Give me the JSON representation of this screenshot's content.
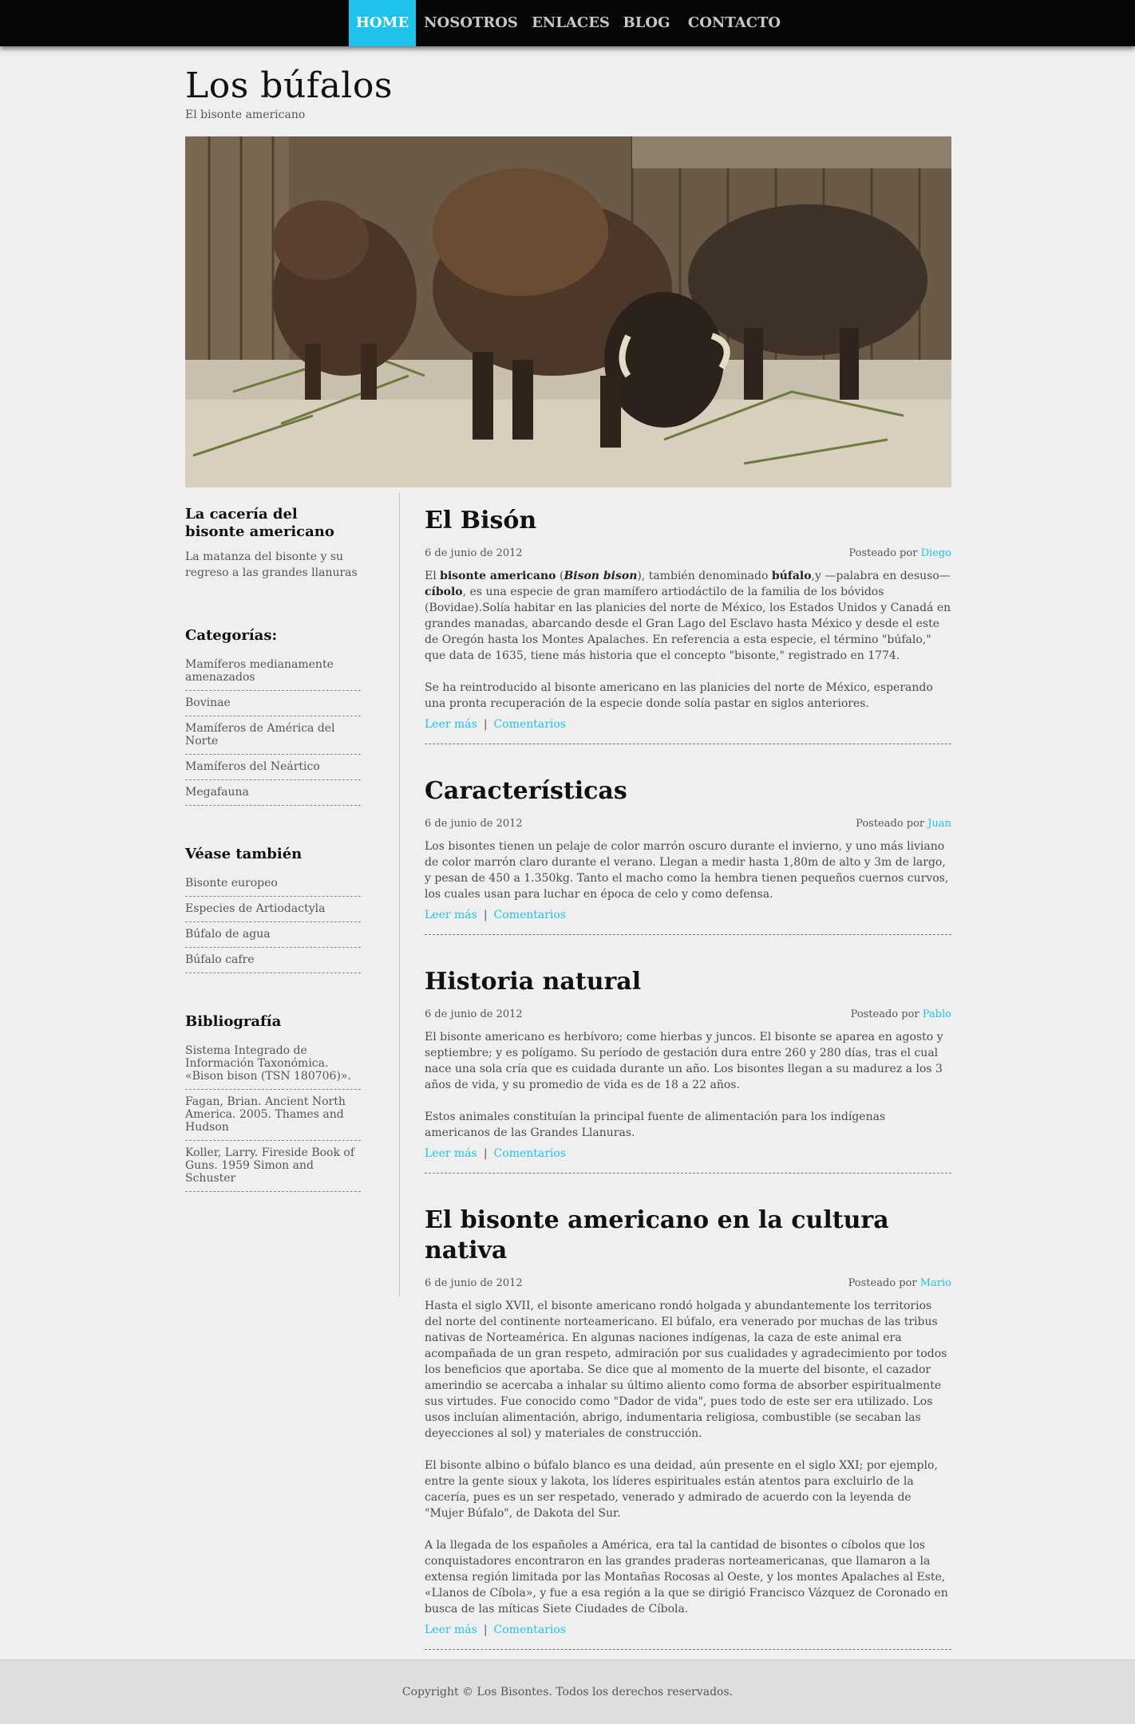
{
  "nav": {
    "items": [
      "HOME",
      "NOSOTROS",
      "ENLACES",
      "BLOG",
      "CONTACTO"
    ],
    "active_index": 0
  },
  "header": {
    "title": "Los búfalos",
    "subtitle": "El bisonte americano"
  },
  "sidebar": {
    "intro_title": "La cacería del bisonte americano",
    "intro_text": "La matanza del bisonte y su regreso a las grandes llanuras",
    "categories_title": "Categorías:",
    "categories": [
      "Mamíferos medianamente amenazados",
      "Bovinae",
      "Mamíferos de América del Norte",
      "Mamíferos del Neártico",
      "Megafauna"
    ],
    "see_also_title": "Véase también",
    "see_also": [
      "Bisonte europeo",
      "Especies de Artiodactyla",
      "Búfalo de agua",
      "Búfalo cafre"
    ],
    "bibliography_title": "Bibliografía",
    "bibliography": [
      "Sistema Integrado de Información Taxonómica. «Bison bison (TSN 180706)».",
      "Fagan, Brian. Ancient North America. 2005. Thames and Hudson",
      "Koller, Larry. Fireside Book of Guns. 1959 Simon and Schuster"
    ]
  },
  "posts": [
    {
      "title": "El Bisón",
      "date": "6 de junio de 2012",
      "posted_by": "Posteado por",
      "author": "Diego",
      "p1_a": "El ",
      "p1_b1": "bisonte americano",
      "p1_c": " (",
      "p1_i": "Bison bison",
      "p1_d": "), también denominado ",
      "p1_b2": "búfalo",
      "p1_e": ",y —palabra en desuso— ",
      "p1_b3": "cíbolo",
      "p1_f": ", es una especie de gran mamífero artiodáctilo de la familia de los bóvidos (Bovidae).Solía habitar en las planicies del norte de México, los Estados Unidos y Canadá en grandes manadas, abarcando desde el Gran Lago del Esclavo hasta México y desde el este de Oregón hasta los Montes Apalaches. En referencia a esta especie, el término \"búfalo,\" que data de 1635, tiene más historia que el concepto \"bisonte,\" registrado en 1774.",
      "p2": "Se ha reintroducido al bisonte americano en las planicies del norte de México, esperando una pronta recuperación de la especie donde solía pastar en siglos anteriores.",
      "read_more": "Leer más",
      "separator": "|",
      "comments": "Comentarios"
    },
    {
      "title": "Características",
      "date": "6 de junio de 2012",
      "posted_by": "Posteado por",
      "author": "Juan",
      "p1": "Los bisontes tienen un pelaje de color marrón oscuro durante el invierno, y uno más liviano de color marrón claro durante el verano. Llegan a medir hasta 1,80m de alto y 3m de largo, y pesan de 450 a 1.350kg. Tanto el macho como la hembra tienen pequeños cuernos curvos, los cuales usan para luchar en época de celo y como defensa.",
      "read_more": "Leer más",
      "separator": "|",
      "comments": "Comentarios"
    },
    {
      "title": "Historia natural",
      "date": "6 de junio de 2012",
      "posted_by": "Posteado por",
      "author": "Pablo",
      "p1": "El bisonte americano es herbívoro; come hierbas y juncos. El bisonte se aparea en agosto y septiembre; y es polígamo. Su período de gestación dura entre 260 y 280 días, tras el cual nace una sola cría que es cuidada durante un año. Los bisontes llegan a su madurez a los 3 años de vida, y su promedio de vida es de 18 a 22 años.",
      "p2": "Estos animales constituían la principal fuente de alimentación para los indígenas americanos de las Grandes Llanuras.",
      "read_more": "Leer más",
      "separator": "|",
      "comments": "Comentarios"
    },
    {
      "title": "El bisonte americano en la cultura nativa",
      "date": "6 de junio de 2012",
      "posted_by": "Posteado por",
      "author": "Mario",
      "p1": "Hasta el siglo XVII, el bisonte americano rondó holgada y abundantemente los territorios del norte del continente norteamericano. El búfalo, era venerado por muchas de las tribus nativas de Norteamérica. En algunas naciones indígenas, la caza de este animal era acompañada de un gran respeto, admiración por sus cualidades y agradecimiento por todos los beneficios que aportaba. Se dice que al momento de la muerte del bisonte, el cazador amerindio se acercaba a inhalar su último aliento como forma de absorber espiritualmente sus virtudes. Fue conocido como \"Dador de vida\", pues todo de este ser era utilizado. Los usos incluían alimentación, abrigo, indumentaria religiosa, combustible (se secaban las deyecciones al sol) y materiales de construcción.",
      "p2": "El bisonte albino o búfalo blanco es una deidad, aún presente en el siglo XXI; por ejemplo, entre la gente sioux y lakota, los líderes espirituales están atentos para excluirlo de la cacería, pues es un ser respetado, venerado y admirado de acuerdo con la leyenda de \"Mujer Búfalo\", de Dakota del Sur.",
      "p3": "A la llegada de los españoles a América, era tal la cantidad de bisontes o cíbolos que los conquistadores encontraron en las grandes praderas norteamericanas, que llamaron a la extensa región limitada por las Montañas Rocosas al Oeste, y los montes Apalaches al Este, «Llanos de Cíbola», y fue a esa región a la que se dirigió Francisco Vázquez de Coronado en busca de las míticas Siete Ciudades de Cíbola.",
      "read_more": "Leer más",
      "separator": "|",
      "comments": "Comentarios"
    }
  ],
  "footer": {
    "text": "Copyright © Los Bisontes. Todos los derechos reservados."
  },
  "colors": {
    "accent": "#1ec3ec",
    "nav_bg": "#060606",
    "page_bg": "#efefef"
  }
}
